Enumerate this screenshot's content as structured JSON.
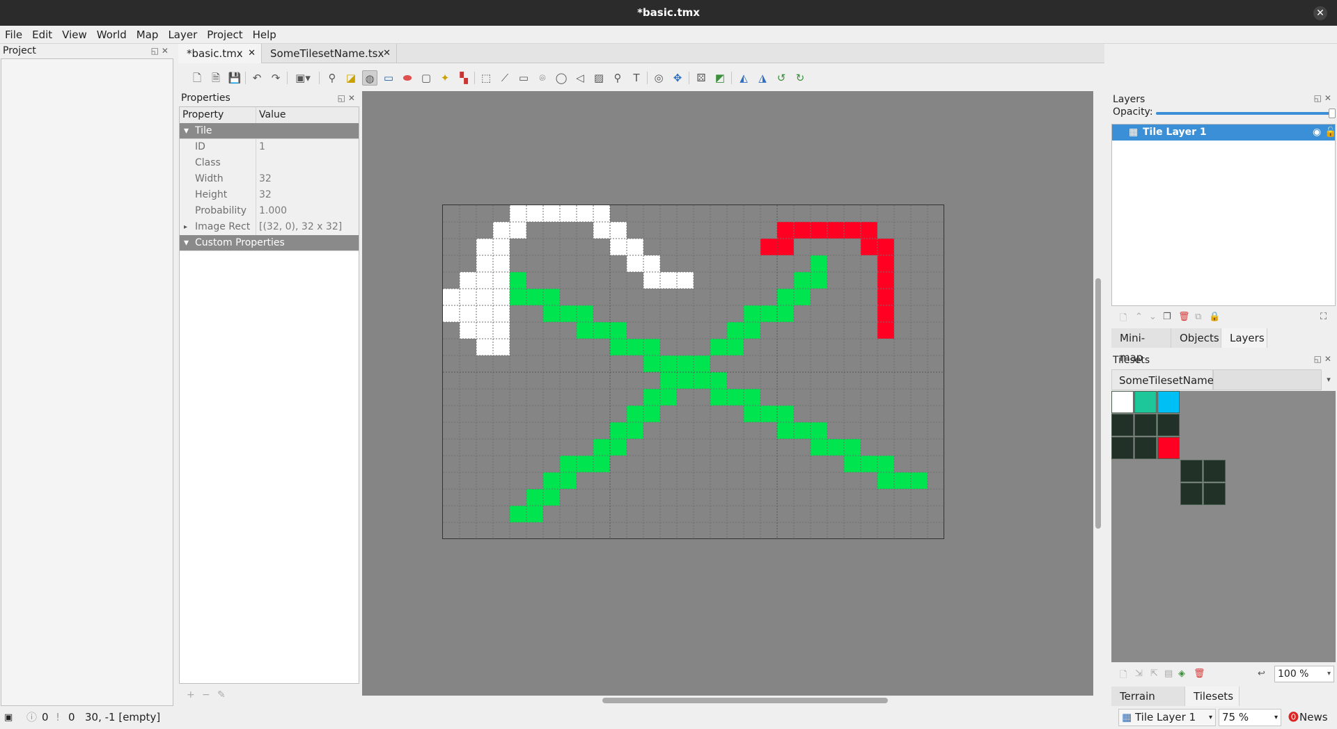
{
  "window": {
    "title": "*basic.tmx",
    "close_glyph": "✕"
  },
  "menu": [
    "File",
    "Edit",
    "View",
    "World",
    "Map",
    "Layer",
    "Project",
    "Help"
  ],
  "project_dock": {
    "title": "Project"
  },
  "tabs": [
    {
      "label": "*basic.tmx",
      "close": "✕"
    },
    {
      "label": "SomeTilesetName.tsx",
      "close": "✕"
    }
  ],
  "toolbar_icons": [
    "new-map-icon",
    "new-file-icon",
    "save-icon",
    "undo-icon",
    "redo-icon",
    "commands-icon",
    "stamp-brush-icon",
    "terrain-brush-icon",
    "bucket-fill-icon",
    "shape-fill-icon",
    "eraser-icon",
    "rect-select-icon",
    "magic-wand-icon",
    "select-same-tile-icon",
    "select-objects-icon",
    "edit-polygons-icon",
    "insert-rectangle-icon",
    "insert-point-icon",
    "insert-ellipse-icon",
    "insert-polygon-icon",
    "insert-image-icon",
    "insert-tile-icon",
    "insert-text-icon",
    "world-tool-icon",
    "move-icon",
    "random-mode-icon",
    "wang-fill-icon",
    "flip-horizontal-icon",
    "flip-vertical-icon",
    "rotate-left-icon",
    "rotate-right-icon"
  ],
  "properties": {
    "title": "Properties",
    "header": {
      "property": "Property",
      "value": "Value"
    },
    "group_tile": "Tile",
    "rows": [
      {
        "key": "ID",
        "value": "1"
      },
      {
        "key": "Class",
        "value": ""
      },
      {
        "key": "Width",
        "value": "32"
      },
      {
        "key": "Height",
        "value": "32"
      },
      {
        "key": "Probability",
        "value": "1.000"
      },
      {
        "key": "Image Rect",
        "value": "[(32, 0), 32 x 32]"
      }
    ],
    "group_custom": "Custom Properties"
  },
  "map": {
    "cols": 30,
    "rows": 20,
    "colors": {
      "white": "#ffffff",
      "green": "#00e54f",
      "red": "#ff0022"
    },
    "white_cells": [
      [
        4,
        0
      ],
      [
        5,
        0
      ],
      [
        6,
        0
      ],
      [
        7,
        0
      ],
      [
        8,
        0
      ],
      [
        9,
        0
      ],
      [
        3,
        1
      ],
      [
        4,
        1
      ],
      [
        9,
        1
      ],
      [
        10,
        1
      ],
      [
        2,
        2
      ],
      [
        3,
        2
      ],
      [
        10,
        2
      ],
      [
        11,
        2
      ],
      [
        2,
        3
      ],
      [
        3,
        3
      ],
      [
        11,
        3
      ],
      [
        12,
        3
      ],
      [
        1,
        4
      ],
      [
        2,
        4
      ],
      [
        3,
        4
      ],
      [
        12,
        4
      ],
      [
        13,
        4
      ],
      [
        14,
        4
      ],
      [
        0,
        5
      ],
      [
        1,
        5
      ],
      [
        2,
        5
      ],
      [
        3,
        5
      ],
      [
        0,
        6
      ],
      [
        1,
        6
      ],
      [
        2,
        6
      ],
      [
        3,
        6
      ],
      [
        1,
        7
      ],
      [
        2,
        7
      ],
      [
        3,
        7
      ],
      [
        2,
        8
      ],
      [
        3,
        8
      ]
    ],
    "green_cells": [
      [
        4,
        4
      ],
      [
        4,
        5
      ],
      [
        5,
        5
      ],
      [
        6,
        5
      ],
      [
        6,
        6
      ],
      [
        7,
        6
      ],
      [
        8,
        6
      ],
      [
        8,
        7
      ],
      [
        9,
        7
      ],
      [
        10,
        7
      ],
      [
        10,
        8
      ],
      [
        11,
        8
      ],
      [
        12,
        8
      ],
      [
        12,
        9
      ],
      [
        13,
        9
      ],
      [
        14,
        9
      ],
      [
        15,
        9
      ],
      [
        13,
        10
      ],
      [
        14,
        10
      ],
      [
        15,
        10
      ],
      [
        16,
        10
      ],
      [
        12,
        11
      ],
      [
        13,
        11
      ],
      [
        16,
        11
      ],
      [
        17,
        11
      ],
      [
        18,
        11
      ],
      [
        11,
        12
      ],
      [
        12,
        12
      ],
      [
        18,
        12
      ],
      [
        19,
        12
      ],
      [
        20,
        12
      ],
      [
        10,
        13
      ],
      [
        11,
        13
      ],
      [
        20,
        13
      ],
      [
        21,
        13
      ],
      [
        22,
        13
      ],
      [
        9,
        14
      ],
      [
        10,
        14
      ],
      [
        22,
        14
      ],
      [
        23,
        14
      ],
      [
        24,
        14
      ],
      [
        7,
        15
      ],
      [
        8,
        15
      ],
      [
        9,
        15
      ],
      [
        24,
        15
      ],
      [
        25,
        15
      ],
      [
        26,
        15
      ],
      [
        6,
        16
      ],
      [
        7,
        16
      ],
      [
        26,
        16
      ],
      [
        27,
        16
      ],
      [
        28,
        16
      ],
      [
        5,
        17
      ],
      [
        6,
        17
      ],
      [
        4,
        18
      ],
      [
        5,
        18
      ],
      [
        22,
        3
      ],
      [
        21,
        4
      ],
      [
        22,
        4
      ],
      [
        20,
        5
      ],
      [
        21,
        5
      ],
      [
        18,
        6
      ],
      [
        19,
        6
      ],
      [
        20,
        6
      ],
      [
        17,
        7
      ],
      [
        18,
        7
      ],
      [
        16,
        8
      ],
      [
        17,
        8
      ],
      [
        15,
        9
      ]
    ],
    "red_cells": [
      [
        20,
        1
      ],
      [
        21,
        1
      ],
      [
        22,
        1
      ],
      [
        23,
        1
      ],
      [
        24,
        1
      ],
      [
        25,
        1
      ],
      [
        19,
        2
      ],
      [
        20,
        2
      ],
      [
        25,
        2
      ],
      [
        26,
        2
      ],
      [
        26,
        3
      ],
      [
        26,
        4
      ],
      [
        26,
        5
      ],
      [
        26,
        6
      ],
      [
        26,
        7
      ]
    ]
  },
  "layers": {
    "title": "Layers",
    "opacity_label": "Opacity:",
    "items": [
      {
        "name": "Tile Layer 1"
      }
    ],
    "tabs": [
      "Mini-map",
      "Objects",
      "Layers"
    ]
  },
  "tilesets": {
    "title": "Tilesets",
    "tab": "SomeTilesetName",
    "zoom": "100 %",
    "bottom_tabs": [
      "Terrain Sets",
      "Tilesets"
    ],
    "tile_colors": {
      "white": "#ffffff",
      "teal": "#1ec79a",
      "cyan": "#00bff5",
      "dark": "#223127",
      "red": "#ff0022"
    }
  },
  "status": {
    "errors": "0",
    "warnings": "0",
    "position": "30, -1 [empty]",
    "layer": "Tile Layer 1",
    "zoom": "75 %",
    "news": "News"
  }
}
